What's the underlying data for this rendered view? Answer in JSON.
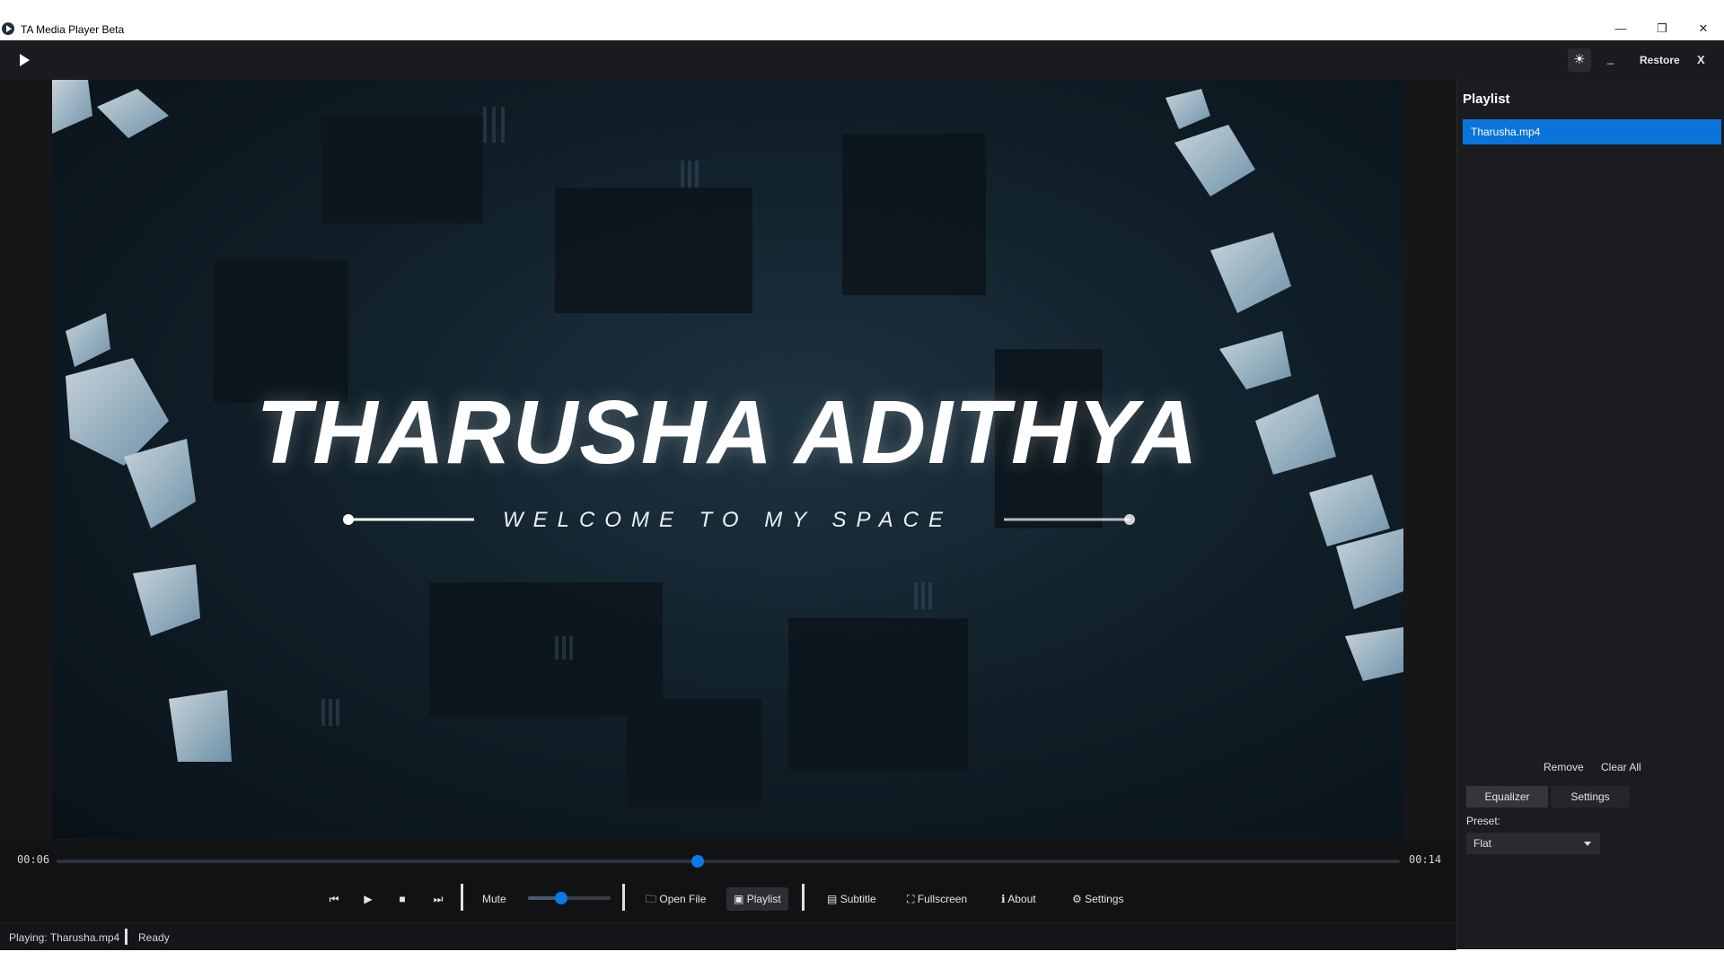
{
  "window": {
    "title": "TA Media Player Beta",
    "minimize": "—",
    "maximize": "❐",
    "close": "✕"
  },
  "toolbar": {
    "theme_icon": "☀",
    "minimize_label": "_",
    "restore_label": "Restore",
    "close_label": "X"
  },
  "video": {
    "headline": "THARUSHA ADITHYA",
    "tagline": "WELCOME TO MY SPACE"
  },
  "seek": {
    "current_time": "00:06",
    "total_time": "00:14",
    "progress": 0.477
  },
  "controls": {
    "prev_icon": "⏮",
    "play_icon": "▶",
    "stop_icon": "■",
    "next_icon": "⏭",
    "mute_label": "Mute",
    "volume": 0.4,
    "open_file_label": "Open File",
    "playlist_label": "Playlist",
    "subtitle_label": "Subtitle",
    "fullscreen_label": "Fullscreen",
    "about_label": "About",
    "settings_label": "Settings"
  },
  "status": {
    "playing": "Playing: Tharusha.mp4",
    "state": "Ready"
  },
  "sidebar": {
    "title": "Playlist",
    "items": [
      "Tharusha.mp4"
    ],
    "remove_label": "Remove",
    "clear_all_label": "Clear All",
    "tabs": [
      "Equalizer",
      "Settings"
    ],
    "preset_label": "Preset:",
    "preset_value": "Flat"
  },
  "colors": {
    "accent": "#0a7ae8",
    "selection": "#0a74da",
    "panel": "#1b1c1f",
    "background": "#111214"
  }
}
